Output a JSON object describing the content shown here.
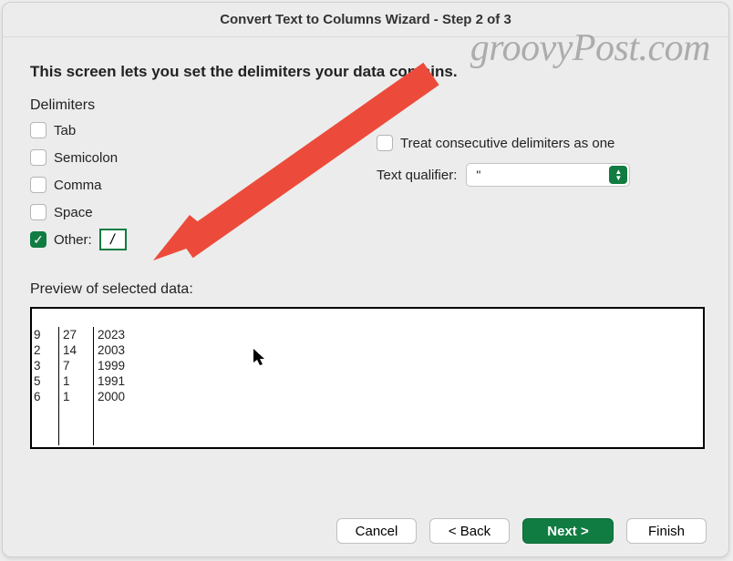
{
  "title": "Convert Text to Columns Wizard - Step 2 of 3",
  "instruction": "This screen lets you set the delimiters your data contains.",
  "delimiters": {
    "heading": "Delimiters",
    "tab": "Tab",
    "semicolon": "Semicolon",
    "comma": "Comma",
    "space": "Space",
    "other": "Other:",
    "other_value": "/"
  },
  "consecutive_label": "Treat consecutive delimiters as one",
  "qualifier_label": "Text qualifier:",
  "qualifier_value": "\"",
  "preview_label": "Preview of selected data:",
  "preview": {
    "col1": [
      "9",
      "2",
      "3",
      "5",
      "6"
    ],
    "col2": [
      "27",
      "14",
      "7",
      "1",
      "1"
    ],
    "col3": [
      "2023",
      "2003",
      "1999",
      "1991",
      "2000"
    ]
  },
  "buttons": {
    "cancel": "Cancel",
    "back": "< Back",
    "next": "Next >",
    "finish": "Finish"
  },
  "watermark": "groovyPost.com"
}
